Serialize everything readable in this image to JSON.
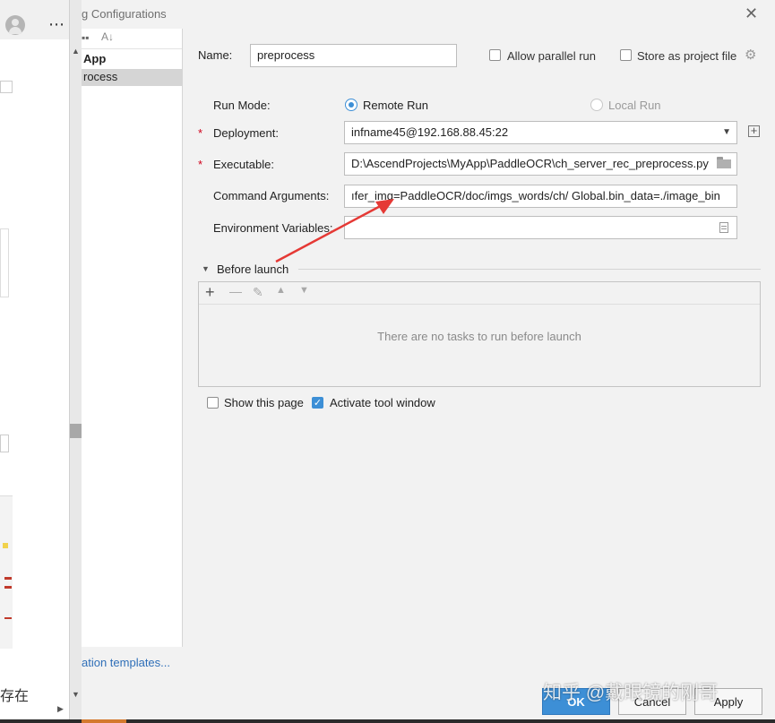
{
  "browser": {
    "more_icon": "⋯",
    "cjk_text": "存在"
  },
  "dialog": {
    "title": "g Configurations",
    "tree": {
      "item_app": "App",
      "item_process": "rocess"
    },
    "templates_link": "ation templates...",
    "name_label": "Name:",
    "name_value": "preprocess",
    "allow_parallel_label": "Allow parallel run",
    "store_project_label": "Store as project file",
    "run_mode_label": "Run Mode:",
    "remote_run_label": "Remote Run",
    "local_run_label": "Local Run",
    "deployment_label": "Deployment:",
    "deployment_value": "infname45@192.168.88.45:22",
    "executable_label": "Executable:",
    "executable_value": "D:\\AscendProjects\\MyApp\\PaddleOCR\\ch_server_rec_preprocess.py",
    "command_args_label": "Command Arguments:",
    "command_args_value": "ıfer_img=PaddleOCR/doc/imgs_words/ch/  Global.bin_data=./image_bin",
    "env_vars_label": "Environment Variables:",
    "env_vars_value": "",
    "before_launch_label": "Before launch",
    "no_tasks_text": "There are no tasks to run before launch",
    "show_page_label": "Show this page",
    "activate_tool_label": "Activate tool window",
    "ok_label": "OK",
    "cancel_label": "Cancel",
    "apply_label": "Apply",
    "required_mark": "*"
  },
  "watermark": "知乎 @戴眼镜的刚哥",
  "colors": {
    "accent": "#3d8fd6",
    "required": "#d0021b",
    "arrow": "#e53935"
  }
}
